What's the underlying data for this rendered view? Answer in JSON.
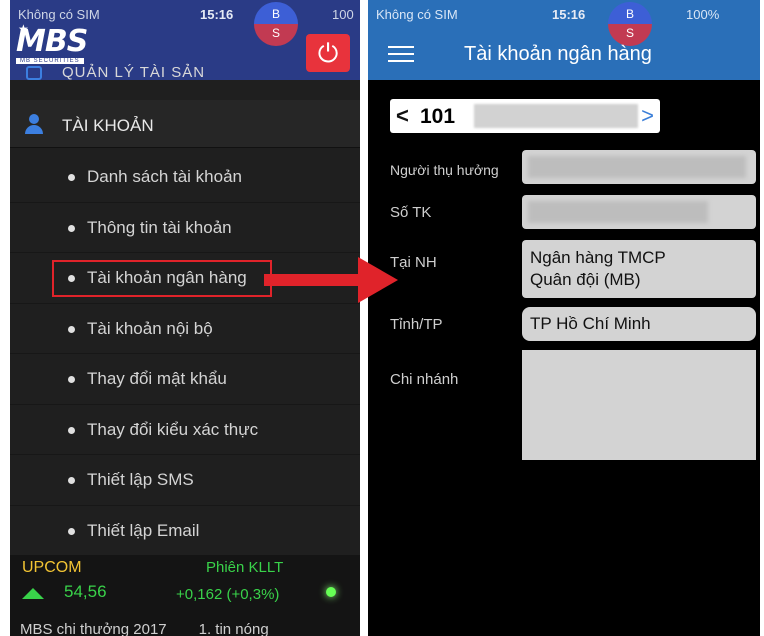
{
  "left_phone": {
    "status": {
      "carrier": "Không có SIM",
      "time": "15:16",
      "battery": "100"
    },
    "badge": {
      "top": "B",
      "bottom": "S"
    },
    "logo": {
      "text": "MBS",
      "subtitle": "MB SECURITIES"
    },
    "partial_menu": "QUẢN LÝ TÀI SẢN",
    "section": "TÀI KHOẢN",
    "menu_items": [
      {
        "label": "Danh sách tài khoản"
      },
      {
        "label": "Thông tin tài khoản"
      },
      {
        "label": "Tài khoản ngân hàng"
      },
      {
        "label": "Tài khoản nội bộ"
      },
      {
        "label": "Thay đổi mật khẩu"
      },
      {
        "label": "Thay đổi kiểu xác thực"
      },
      {
        "label": "Thiết lập SMS"
      },
      {
        "label": "Thiết lập Email"
      }
    ],
    "highlighted_item": "Tài khoản ngân hàng",
    "ticker": {
      "exchange": "UPCOM",
      "session": "Phiên KLLT",
      "index": "54,56",
      "change": "+0,162 (+0,3%)",
      "news_a": "MBS chi thưởng 2017",
      "news_b": "1. tin nóng"
    }
  },
  "right_phone": {
    "status": {
      "carrier": "Không có SIM",
      "time": "15:16",
      "battery": "100%"
    },
    "badge": {
      "top": "B",
      "bottom": "S"
    },
    "title": "Tài khoản ngân hàng",
    "account": {
      "prefix": "101",
      "prev": "<",
      "next": ">"
    },
    "form": {
      "beneficiary_label": "Người thụ hưởng",
      "account_no_label": "Số TK",
      "bank_label": "Tại NH",
      "bank_value": "Ngân hàng TMCP\nQuân đội (MB)",
      "province_label": "Tỉnh/TP",
      "province_value": "TP  Hồ Chí Minh",
      "branch_label": "Chi nhánh",
      "branch_value": ""
    }
  },
  "colors": {
    "brand_blue": "#2a3b86",
    "header_blue": "#2a6fb8",
    "highlight_red": "#e0232a",
    "positive_green": "#39d24a",
    "exchange_yellow": "#f2c433"
  },
  "icons": [
    "star-icon",
    "power-icon",
    "wallet-icon",
    "person-icon",
    "bullet-icon",
    "arrow-right-icon",
    "hamburger-icon",
    "chevron-left-icon",
    "chevron-right-icon",
    "up-triangle-icon",
    "status-led-icon",
    "wifi-icon",
    "battery-icon"
  ]
}
